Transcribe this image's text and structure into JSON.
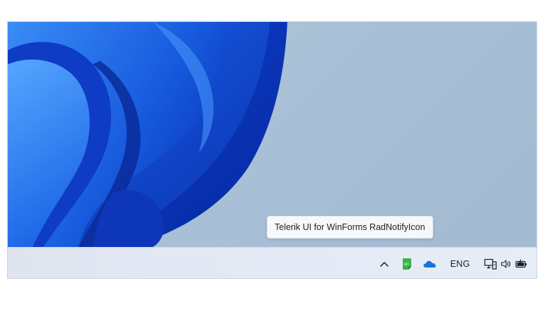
{
  "tooltip": {
    "text": "Telerik UI for WinForms RadNotifyIcon"
  },
  "tray": {
    "show_hidden_icons": "chevron-up-icon",
    "notify_icon": "telerik-winforms-icon",
    "cloud_icon": "onedrive-icon",
    "language": "ENG",
    "network_icon": "network-icon",
    "volume_icon": "volume-icon",
    "battery_icon": "battery-icon"
  },
  "colors": {
    "wallpaper_bg": "#a9c0d6",
    "bloom_dark": "#0a2fb0",
    "bloom_light": "#2f7df0",
    "taskbar": "#e4eaf5",
    "telerik_green": "#3bb24a",
    "onedrive_blue": "#1a73d9"
  }
}
